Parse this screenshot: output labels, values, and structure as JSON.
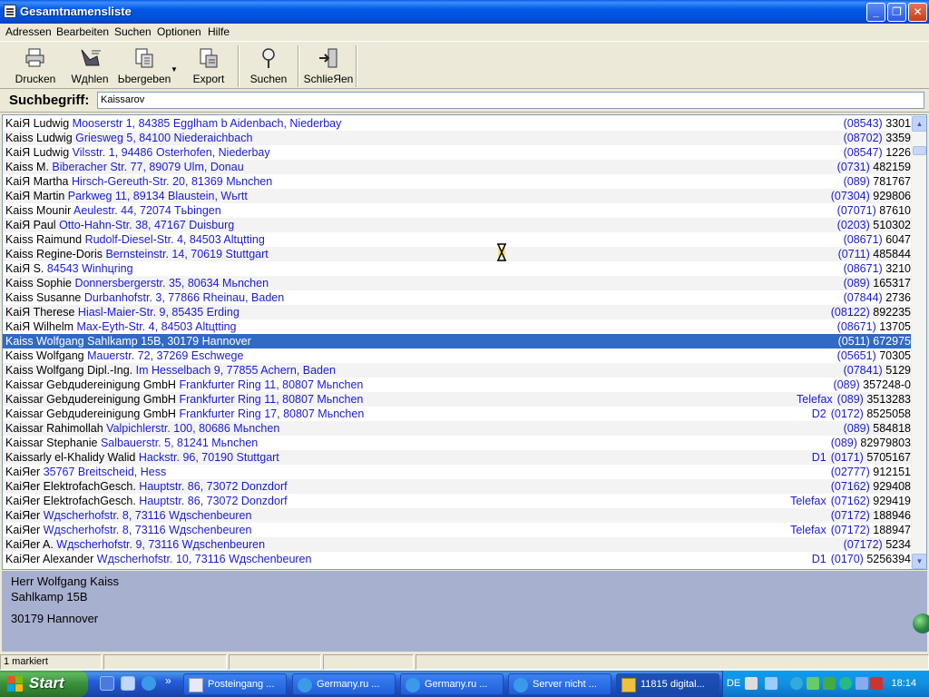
{
  "window": {
    "title": "Gesamtnamensliste",
    "controls": {
      "minimize": "_",
      "maximize": "❐",
      "close": "✕"
    }
  },
  "menu": [
    "Adressen",
    "Bearbeiten",
    "Suchen",
    "Optionen",
    "Hilfe"
  ],
  "toolbar": [
    {
      "label": "Drucken",
      "icon": "printer-icon"
    },
    {
      "label": "Wдhlen",
      "icon": "phone-dial-icon"
    },
    {
      "label": "Ьbergeben",
      "icon": "transfer-icon"
    },
    {
      "label": "Export",
      "icon": "export-icon"
    },
    {
      "label": "Suchen",
      "icon": "search-icon"
    },
    {
      "label": "SchlieЯen",
      "icon": "exit-door-icon"
    }
  ],
  "search": {
    "label": "Suchbegriff:",
    "value": "Kaissarov"
  },
  "list": {
    "rows": [
      {
        "name": "KaiЯ Ludwig",
        "addr": "Mooserstr 1, 84385 Egglham b Aidenbach, Niederbay",
        "pfx": "",
        "area": "(08543)",
        "num": "3301"
      },
      {
        "name": "Kaiss Ludwig",
        "addr": "Griesweg 5, 84100 Niederaichbach",
        "pfx": "",
        "area": "(08702)",
        "num": "3359"
      },
      {
        "name": "KaiЯ Ludwig",
        "addr": "Vilsstr. 1, 94486 Osterhofen, Niederbay",
        "pfx": "",
        "area": "(08547)",
        "num": "1226"
      },
      {
        "name": "Kaiss M.",
        "addr": "Biberacher Str. 77, 89079 Ulm, Donau",
        "pfx": "",
        "area": "(0731)",
        "num": "482159"
      },
      {
        "name": "KaiЯ Martha",
        "addr": "Hirsch-Gereuth-Str. 20, 81369 Mьnchen",
        "pfx": "",
        "area": "(089)",
        "num": "781767"
      },
      {
        "name": "KaiЯ Martin",
        "addr": "Parkweg 11, 89134 Blaustein, Wьrtt",
        "pfx": "",
        "area": "(07304)",
        "num": "929806"
      },
      {
        "name": "Kaiss Mounir",
        "addr": "Aeulestr. 44, 72074 Tьbingen",
        "pfx": "",
        "area": "(07071)",
        "num": "87610"
      },
      {
        "name": "KaiЯ Paul",
        "addr": "Otto-Hahn-Str. 38, 47167 Duisburg",
        "pfx": "",
        "area": "(0203)",
        "num": "510302"
      },
      {
        "name": "Kaiss Raimund",
        "addr": "Rudolf-Diesel-Str. 4, 84503 Altцtting",
        "pfx": "",
        "area": "(08671)",
        "num": "6047"
      },
      {
        "name": "Kaiss Regine-Doris",
        "addr": "Bernsteinstr. 14, 70619 Stuttgart",
        "pfx": "",
        "area": "(0711)",
        "num": "485844"
      },
      {
        "name": "KaiЯ S.",
        "addr": "84543 Winhцring",
        "pfx": "",
        "area": "(08671)",
        "num": "3210"
      },
      {
        "name": "Kaiss Sophie",
        "addr": "Donnersbergerstr. 35, 80634 Mьnchen",
        "pfx": "",
        "area": "(089)",
        "num": "165317"
      },
      {
        "name": "Kaiss Susanne",
        "addr": "Durbanhofstr. 3, 77866 Rheinau, Baden",
        "pfx": "",
        "area": "(07844)",
        "num": "2736"
      },
      {
        "name": "KaiЯ Therese",
        "addr": "Hiasl-Maier-Str. 9, 85435 Erding",
        "pfx": "",
        "area": "(08122)",
        "num": "892235"
      },
      {
        "name": "KaiЯ Wilhelm",
        "addr": "Max-Eyth-Str. 4, 84503 Altцtting",
        "pfx": "",
        "area": "(08671)",
        "num": "13705"
      },
      {
        "name": "Kaiss Wolfgang",
        "addr": "Sahlkamp 15B, 30179 Hannover",
        "pfx": "",
        "area": "(0511)",
        "num": "672975",
        "selected": true
      },
      {
        "name": "Kaiss Wolfgang",
        "addr": "Mauerstr. 72, 37269 Eschwege",
        "pfx": "",
        "area": "(05651)",
        "num": "70305"
      },
      {
        "name": "Kaiss Wolfgang Dipl.-Ing.",
        "addr": "Im Hesselbach 9, 77855 Achern, Baden",
        "pfx": "",
        "area": "(07841)",
        "num": "5129"
      },
      {
        "name": "Kaissar Gebдudereinigung GmbH",
        "addr": "Frankfurter Ring 11, 80807 Mьnchen",
        "pfx": "",
        "area": "(089)",
        "num": "357248-0"
      },
      {
        "name": "Kaissar Gebдudereinigung GmbH",
        "addr": "Frankfurter Ring 11, 80807 Mьnchen",
        "pfx": "Telefax",
        "area": "(089)",
        "num": "3513283"
      },
      {
        "name": "Kaissar Gebдudereinigung GmbH",
        "addr": "Frankfurter Ring 17, 80807 Mьnchen",
        "pfx": "D2",
        "area": "(0172)",
        "num": "8525058"
      },
      {
        "name": "Kaissar Rahimollah",
        "addr": "Valpichlerstr. 100, 80686 Mьnchen",
        "pfx": "",
        "area": "(089)",
        "num": "584818"
      },
      {
        "name": "Kaissar Stephanie",
        "addr": "Salbauerstr. 5, 81241 Mьnchen",
        "pfx": "",
        "area": "(089)",
        "num": "82979803"
      },
      {
        "name": "Kaissarly el-Khalidy Walid",
        "addr": "Hackstr. 96, 70190 Stuttgart",
        "pfx": "D1",
        "area": "(0171)",
        "num": "5705167"
      },
      {
        "name": "KaiЯer",
        "addr": "35767 Breitscheid, Hess",
        "pfx": "",
        "area": "(02777)",
        "num": "912151"
      },
      {
        "name": "KaiЯer ElektrofachGesch.",
        "addr": "Hauptstr. 86, 73072 Donzdorf",
        "pfx": "",
        "area": "(07162)",
        "num": "929408"
      },
      {
        "name": "KaiЯer ElektrofachGesch.",
        "addr": "Hauptstr. 86, 73072 Donzdorf",
        "pfx": "Telefax",
        "area": "(07162)",
        "num": "929419"
      },
      {
        "name": "KaiЯer",
        "addr": "Wдscherhofstr. 8, 73116 Wдschenbeuren",
        "pfx": "",
        "area": "(07172)",
        "num": "188946"
      },
      {
        "name": "KaiЯer",
        "addr": "Wдscherhofstr. 8, 73116 Wдschenbeuren",
        "pfx": "Telefax",
        "area": "(07172)",
        "num": "188947"
      },
      {
        "name": "KaiЯer A.",
        "addr": "Wдscherhofstr. 9, 73116 Wдschenbeuren",
        "pfx": "",
        "area": "(07172)",
        "num": "5234"
      },
      {
        "name": "KaiЯer Alexander",
        "addr": "Wдscherhofstr. 10, 73116 Wдschenbeuren",
        "pfx": "D1",
        "area": "(0170)",
        "num": "5256394"
      }
    ]
  },
  "detail": {
    "line1": "Herr Wolfgang Kaiss",
    "line2": "Sahlkamp 15B",
    "line3": "30179 Hannover"
  },
  "status": {
    "marked": "1 markiert"
  },
  "taskbar": {
    "start": "Start",
    "tasks": [
      "Posteingang ...",
      "Germany.ru ...",
      "Germany.ru ...",
      "Server nicht ...",
      "11815 digital..."
    ],
    "lang": "DE",
    "clock": "18:14"
  },
  "colors": {
    "selection": "#316ac5",
    "link": "#1a1ad8",
    "detail_bg": "#a8b0d0"
  }
}
